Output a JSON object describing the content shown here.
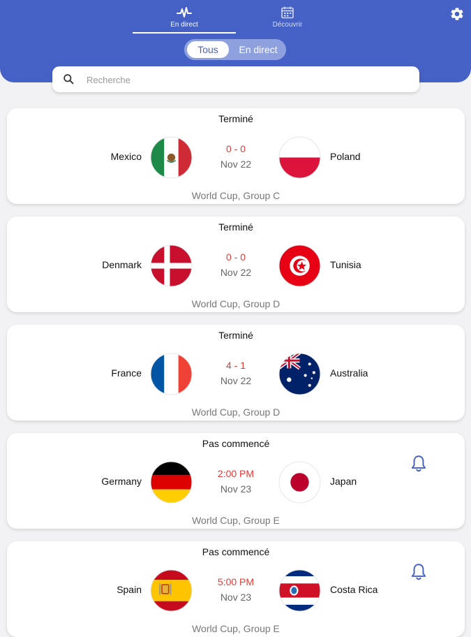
{
  "header": {
    "tabs": [
      {
        "label": "En direct",
        "icon": "pulse-icon",
        "active": true
      },
      {
        "label": "Découvrir",
        "icon": "calendar-icon",
        "active": false
      }
    ],
    "filter": {
      "all_label": "Tous",
      "live_label": "En direct",
      "selected": "Tous"
    },
    "settings_icon": "gear-icon",
    "colors": {
      "primary": "#4661c6",
      "score": "#e53935"
    }
  },
  "search": {
    "placeholder": "Recherche",
    "value": ""
  },
  "matches": [
    {
      "status": "Terminé",
      "home": "Mexico",
      "away": "Poland",
      "score": "0 - 0",
      "date": "Nov 22",
      "competition": "World Cup, Group C",
      "bell": false
    },
    {
      "status": "Terminé",
      "home": "Denmark",
      "away": "Tunisia",
      "score": "0 - 0",
      "date": "Nov 22",
      "competition": "World Cup, Group D",
      "bell": false
    },
    {
      "status": "Terminé",
      "home": "France",
      "away": "Australia",
      "score": "4 - 1",
      "date": "Nov 22",
      "competition": "World Cup, Group D",
      "bell": false
    },
    {
      "status": "Pas commencé",
      "home": "Germany",
      "away": "Japan",
      "score": "2:00 PM",
      "date": "Nov 23",
      "competition": "World Cup, Group E",
      "bell": true
    },
    {
      "status": "Pas commencé",
      "home": "Spain",
      "away": "Costa Rica",
      "score": "5:00 PM",
      "date": "Nov 23",
      "competition": "World Cup, Group E",
      "bell": true
    }
  ]
}
